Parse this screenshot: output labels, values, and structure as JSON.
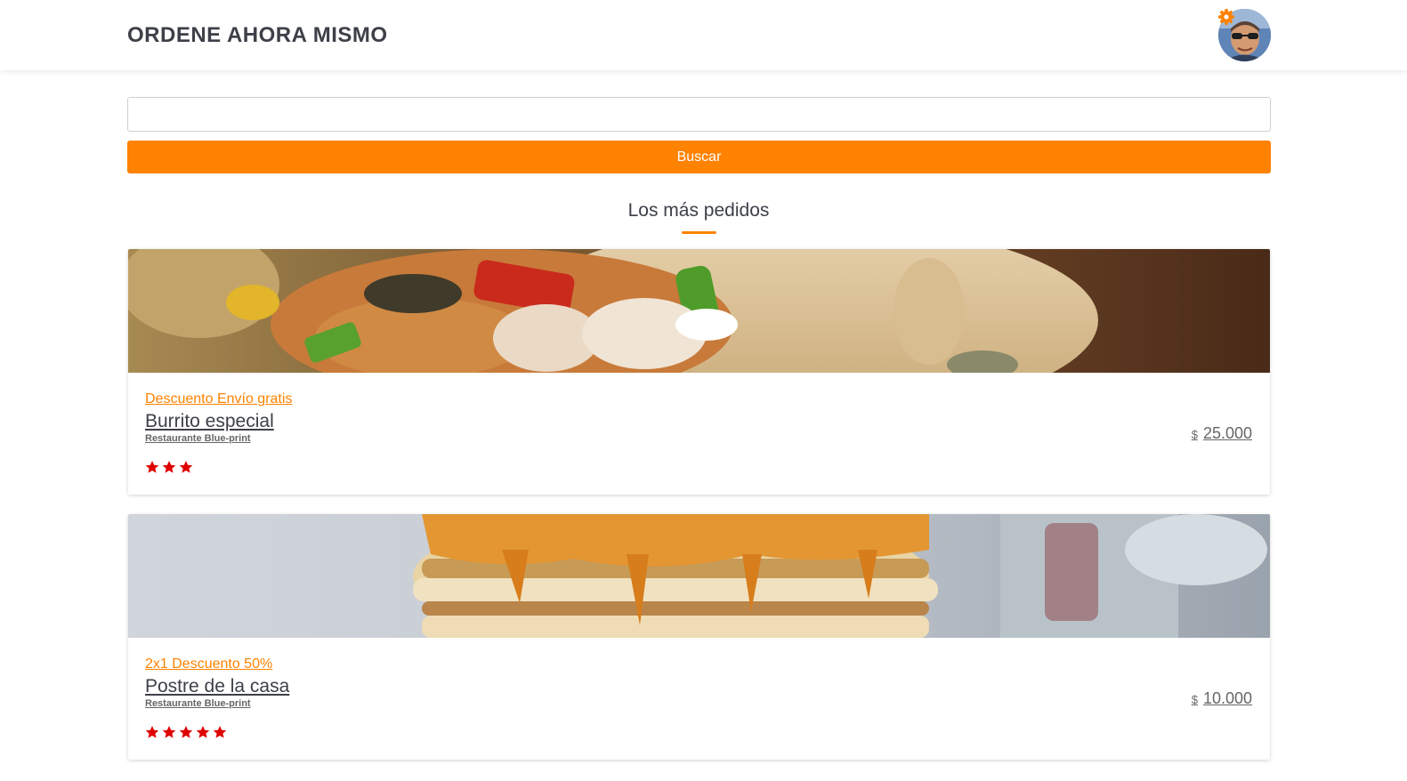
{
  "header": {
    "brand": "ORDENE AHORA MISMO",
    "avatar_icon": "user-avatar",
    "settings_icon": "gear-icon"
  },
  "search": {
    "value": "",
    "placeholder": "",
    "button_label": "Buscar"
  },
  "section": {
    "title": "Los más pedidos"
  },
  "colors": {
    "accent": "#ff8200",
    "star": "#e00000",
    "title_text": "#3d4048"
  },
  "products": [
    {
      "promo": "Descuento Envío gratis",
      "name": "Burrito especial",
      "restaurant": "Restaurante Blue-print",
      "rating": 3,
      "currency": "$",
      "price": "25.000",
      "image": "burrito-photo"
    },
    {
      "promo": "2x1 Descuento 50%",
      "name": "Postre de la casa",
      "restaurant": "Restaurante Blue-print",
      "rating": 5,
      "currency": "$",
      "price": "10.000",
      "image": "pancakes-photo"
    }
  ]
}
